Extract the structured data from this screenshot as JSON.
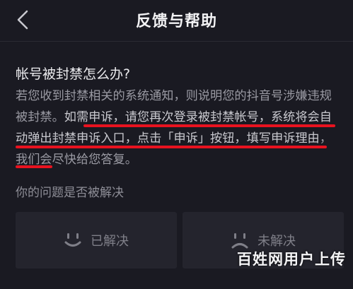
{
  "header": {
    "title": "反馈与帮助",
    "back_icon": "chevron-left-icon"
  },
  "faq": {
    "question": "帐号被封禁怎么办?",
    "answer_parts": [
      "若您收到封禁相关的系统通知，则说明您的抖音号涉嫌违规被封禁。",
      "如需申诉，请您再次登录被封禁帐号，系统将会自动弹出封禁申诉入口，点击「申诉」按钮，填写申诉理由",
      "，我们会尽快给您答复。"
    ],
    "highlight_color": "#e8121f"
  },
  "feedback": {
    "prompt": "你的问题是否被解决",
    "resolved_label": "已解决",
    "unresolved_label": "未解决",
    "resolved_icon": "smile-face-icon",
    "unresolved_icon": "sad-face-icon"
  },
  "watermark": "百姓网用户上传"
}
